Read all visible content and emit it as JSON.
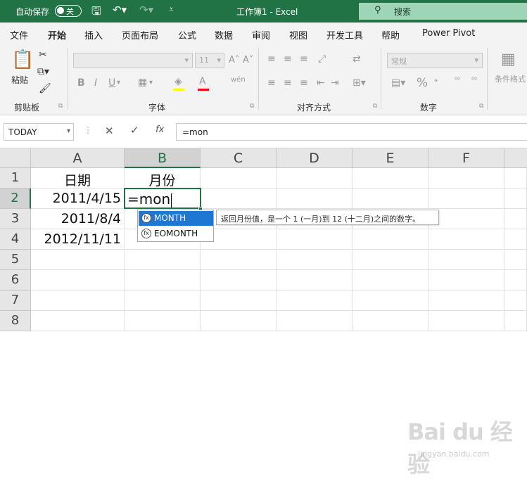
{
  "titlebar": {
    "autosave_label": "自动保存",
    "autosave_state": "关",
    "title": "工作簿1 - Excel",
    "search_label": "搜索"
  },
  "menu": {
    "items": [
      "文件",
      "开始",
      "插入",
      "页面布局",
      "公式",
      "数据",
      "审阅",
      "视图",
      "开发工具",
      "帮助",
      "Power Pivot"
    ],
    "active_index": 1
  },
  "ribbon": {
    "groups": {
      "clipboard": "剪贴板",
      "font": "字体",
      "alignment": "对齐方式",
      "number": "数字"
    },
    "paste_label": "粘贴",
    "font_size": "11",
    "number_format": "常规",
    "cond_format_label": "条件格式",
    "wen_label": "wén",
    "colors": {
      "font_color_bar": "#ff0000",
      "fill_color_bar": "#ffff00"
    }
  },
  "formula_bar": {
    "name_box": "TODAY",
    "fx_label": "fx",
    "content": "=mon"
  },
  "grid": {
    "columns": [
      "A",
      "B",
      "C",
      "D",
      "E",
      "F"
    ],
    "rows": [
      "1",
      "2",
      "3",
      "4",
      "5",
      "6",
      "7",
      "8"
    ],
    "cells": {
      "A1": "日期",
      "B1": "月份",
      "A2": "2011/4/15",
      "A3": "2011/8/4",
      "A4": "2012/11/11"
    },
    "active_cell_text": "=mon"
  },
  "autocomplete": {
    "items": [
      "MONTH",
      "EOMONTH"
    ],
    "selected": 0,
    "icon_text": "fx",
    "tooltip": "返回月份值，是一个 1 (一月)到 12 (十二月)之间的数字。"
  },
  "watermark": {
    "main": "Bai du 经验",
    "sub": "jingyan.baidu.com"
  }
}
